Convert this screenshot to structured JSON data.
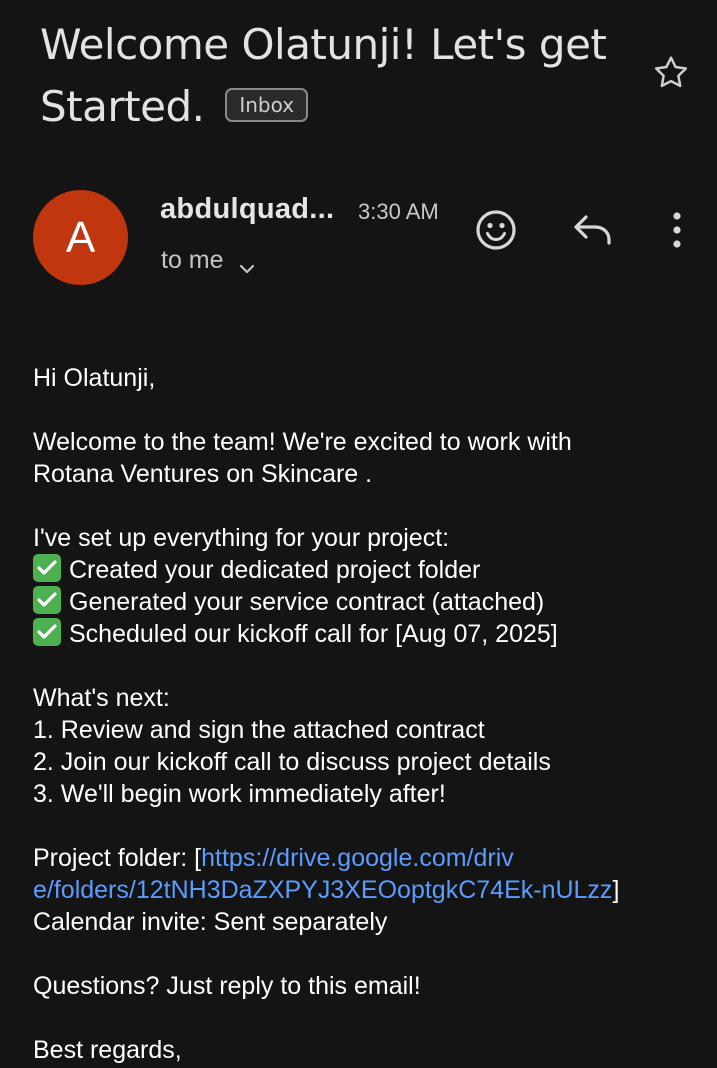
{
  "email": {
    "subject": "Welcome Olatunji! Let's get Started.",
    "label": "Inbox",
    "sender": "abdulquad...",
    "avatar_initial": "A",
    "avatar_color": "#c0360e",
    "time": "3:30 AM",
    "recipient": "to me"
  },
  "icons": {
    "star": "star-outline-icon",
    "emoji": "emoji-react-icon",
    "reply": "reply-icon",
    "more": "more-vert-icon",
    "chevron": "chevron-down-icon",
    "check": "check-mark-button-emoji"
  },
  "body": {
    "greeting": "Hi Olatunji,",
    "intro_line1": "Welcome to the team! We're excited to work with",
    "intro_line2": "Rotana Ventures on Skincare .",
    "setup_heading": "I've set up everything for your project:",
    "checklist": [
      "Created your dedicated project folder",
      "Generated your service contract (attached)",
      "Scheduled our kickoff call for [Aug 07, 2025]"
    ],
    "next_heading": "What's next:",
    "steps": [
      "1. Review and sign the attached contract",
      "2. Join our kickoff call to discuss project details",
      "3. We'll begin work immediately after!"
    ],
    "folder_label": "Project folder: [",
    "folder_link_line1": "https://drive.google.com/driv",
    "folder_link_line2": "e/folders/12tNH3DaZXPYJ3XEOoptgkC74Ek-nULzz",
    "folder_close": "]",
    "calendar_line": "Calendar invite: Sent separately",
    "questions": "Questions? Just reply to this email!",
    "signoff": "Best regards,"
  },
  "colors": {
    "background": "#141414",
    "link": "#5b9cff",
    "check_green": "#4caf50"
  }
}
